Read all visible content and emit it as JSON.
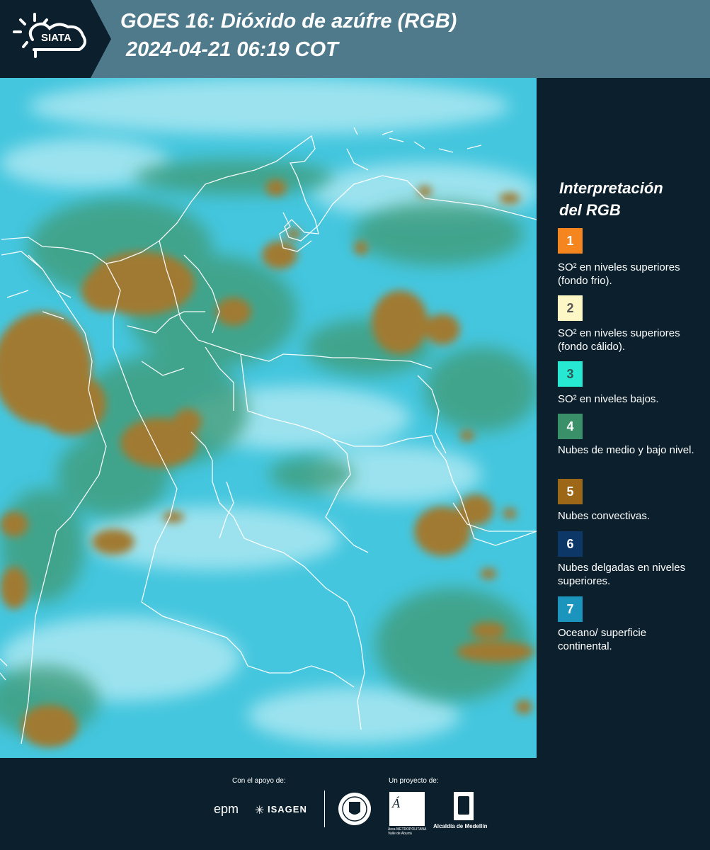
{
  "header": {
    "logo_text": "SIATA",
    "title_line1": "GOES 16: Dióxido de azúfre (RGB)",
    "title_line2": "2024-04-21 06:19 COT"
  },
  "colors": {
    "header_bg": "#4f7a8c",
    "panel_bg": "#0b1f2c",
    "ocean_land": "#3ec3dc",
    "convective": "#a57c2c"
  },
  "legend": {
    "title_line1": "Interpretación",
    "title_line2": "del RGB",
    "items": [
      {
        "number": "1",
        "color": "#f5861f",
        "text": "SO² en niveles superiores (fondo frio)."
      },
      {
        "number": "2",
        "color": "#fcf7c4",
        "text": "SO² en niveles superiores (fondo cálido)."
      },
      {
        "number": "3",
        "color": "#27e8d2",
        "text": "SO² en niveles bajos."
      },
      {
        "number": "4",
        "color": "#3a9068",
        "text": "Nubes de medio y bajo nivel."
      },
      {
        "number": "5",
        "color": "#9c6716",
        "text": "Nubes convectivas."
      },
      {
        "number": "6",
        "color": "#0d3767",
        "text": "Nubes delgadas en niveles superiores."
      },
      {
        "number": "7",
        "color": "#1c95be",
        "text": "Oceano/ superficie continental."
      }
    ]
  },
  "footer": {
    "support_label": "Con el apoyo de:",
    "project_label": "Un proyecto de:",
    "sponsors": [
      "epm",
      "ISAGEN"
    ],
    "partners": [
      "Área METROPOLITANA Valle de Aburrá",
      "Alcaldía de Medellín"
    ]
  }
}
